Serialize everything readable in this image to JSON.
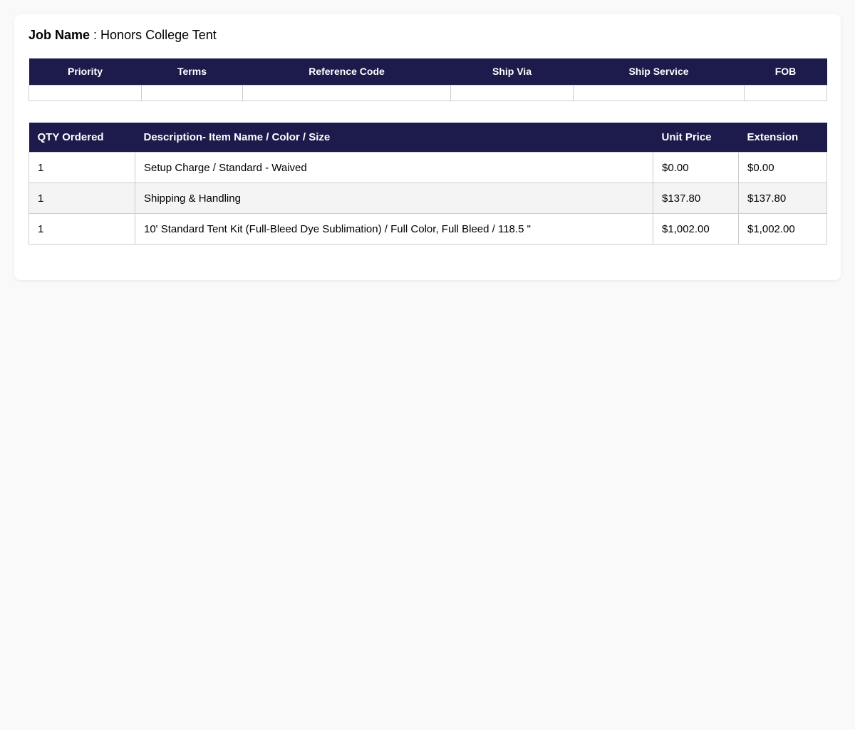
{
  "job": {
    "label": "Job Name",
    "separator": " : ",
    "value": "Honors College Tent"
  },
  "shipping": {
    "headers": [
      "Priority",
      "Terms",
      "Reference Code",
      "Ship Via",
      "Ship Service",
      "FOB"
    ],
    "values": [
      "",
      "",
      "",
      "",
      "",
      ""
    ]
  },
  "items": {
    "headers": [
      "QTY Ordered",
      "Description- Item Name / Color / Size",
      "Unit Price",
      "Extension"
    ],
    "rows": [
      {
        "qty": "1",
        "description": "Setup Charge / Standard - Waived",
        "unit_price": "$0.00",
        "extension": "$0.00"
      },
      {
        "qty": "1",
        "description": "Shipping & Handling",
        "unit_price": "$137.80",
        "extension": "$137.80"
      },
      {
        "qty": "1",
        "description": "10' Standard Tent Kit (Full-Bleed Dye Sublimation) / Full Color, Full Bleed / 118.5 \"",
        "unit_price": "$1,002.00",
        "extension": "$1,002.00"
      }
    ]
  },
  "colors": {
    "header_bg": "#1c1b4b",
    "alt_row_bg": "#f4f4f4",
    "border": "#cccccc"
  }
}
